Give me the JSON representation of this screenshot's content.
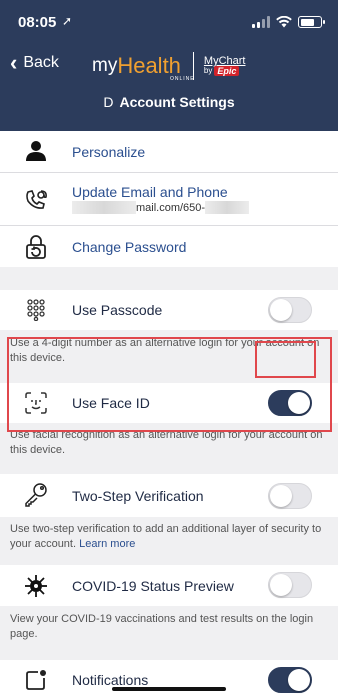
{
  "status": {
    "time": "08:05",
    "location_icon": "location-arrow-icon"
  },
  "nav": {
    "back_label": "Back"
  },
  "logo": {
    "my": "my",
    "health": "Health",
    "online": "ONLINE",
    "mychart_top": "MyChart",
    "mychart_by": "by",
    "epic": "Epic"
  },
  "page": {
    "title_prefix": "D",
    "title": "Account Settings"
  },
  "rows": {
    "personalize": {
      "label": "Personalize",
      "icon": "person-icon"
    },
    "update_email": {
      "label": "Update Email and Phone",
      "sub_email": "mail.com/650-",
      "icon": "contact-at-icon"
    },
    "change_password": {
      "label": "Change Password",
      "icon": "lock-reset-icon"
    },
    "passcode": {
      "label": "Use Passcode",
      "icon": "keypad-icon",
      "enabled": false,
      "desc": "Use a 4-digit number as an alternative login for your account on this device."
    },
    "face_id": {
      "label": "Use Face ID",
      "icon": "face-id-icon",
      "enabled": true,
      "desc": "Use facial recognition as an alternative login for your account on this device."
    },
    "two_step": {
      "label": "Two-Step Verification",
      "icon": "key-icon",
      "enabled": false,
      "desc": "Use two-step verification to add an additional layer of security to your account.",
      "link": "Learn more"
    },
    "covid": {
      "label": "COVID-19 Status Preview",
      "icon": "virus-icon",
      "enabled": false,
      "desc": "View your COVID-19 vaccinations and test results on the login page."
    },
    "notifications": {
      "label": "Notifications",
      "icon": "notification-icon",
      "enabled": true
    }
  },
  "colors": {
    "header": "#2c3c5c",
    "accent": "#f0a030",
    "highlight": "#e0474c",
    "link": "#2b4f8f"
  }
}
